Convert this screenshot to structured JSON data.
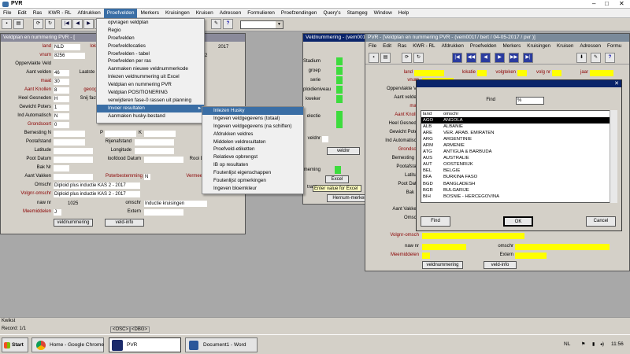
{
  "app": {
    "title": "PVR"
  },
  "menubar": [
    "File",
    "Edit",
    "Ras",
    "KWR - RL",
    "Afdrukken",
    "Proefvelden",
    "Merkers",
    "Kruisingen",
    "Kruisen",
    "Adressen",
    "Formulieren",
    "Proefzendingen",
    "Query's",
    "Stamgeg",
    "Window",
    "Help"
  ],
  "win1": {
    "title": "Veldplan en nummering PVR - ["
  },
  "win2": {
    "title": "Veldnummering - (vem001f)"
  },
  "win3": {
    "title": "PVR - [Veldplan en nummering PVR - (vem001f / bert / 04-05-2017 / pvr )]",
    "menu": [
      "File",
      "Edit",
      "Ras",
      "KWR - RL",
      "Afdrukken",
      "Proefvelden",
      "Merkers",
      "Kruisingen",
      "Kruisen",
      "Adressen",
      "Formu"
    ]
  },
  "form1": {
    "land_label": "land",
    "land_value": "NLD",
    "lokatie_label": "lokat",
    "jaar_value": "2017",
    "jaar_value2": "2",
    "vnum_label": "vnum",
    "vnum_value": "8256",
    "opp_label": "Oppervlakte Veld",
    "aant_velden_label": "Aant velden",
    "aant_velden_value": "46",
    "laatste_label": "Laatste Ve",
    "maat_label": "maat",
    "maat_value": "30",
    "aant_knollen_label": "Aant Knollen",
    "aant_knollen_value": "8",
    "geoog_label": "geoog",
    "heel_label": "Heel Gesneden",
    "heel_value": "H",
    "snij_label": "Snij fact",
    "gewicht_label": "Gewicht Poters",
    "gewicht_value": "1",
    "ind_label": "Ind Automatisch",
    "ind_value": "N",
    "grondsoort_label": "Grondsoort",
    "grondsoort_value": "0",
    "bemesting_label": "Bemesting N",
    "p_label": "P",
    "k_label": "K",
    "pootafstand_label": "Pootafstand",
    "rijenafstand_label": "Rijenafstand",
    "latitude_label": "Latitude",
    "longitude_label": "Longitude",
    "pootdatum_label": "Poot Datum",
    "loofdood_label": "loofdood Datum",
    "rooi_label": "Rooi D",
    "bak_label": "Bak Nr",
    "aant_vakken_label": "Aant Vakken",
    "poterbestemming_label": "Poterbestemming",
    "poterbestemming_value": "N",
    "vermeer_label": "Vermeer",
    "omschr_label": "Omschr",
    "omschr_value": "Diploid plus inductie KAS 2 - 2017",
    "volgnr_label": "Volgnr-omschr",
    "volgnr_value": "Diploid plus inductie KAS 2 - 2017",
    "naw_label": "naw nr",
    "naw_value": "1025",
    "naw_omschr_label": "omschr",
    "naw_omschr_value": "Inductie kruisingen",
    "meemiddelen_label": "Meemiddelen",
    "meemiddelen_value": "J",
    "extern_label": "Extern",
    "btn_veldnummering": "veldnummering",
    "btn_veldinfo": "veld-info"
  },
  "proefvelden_menu": [
    "opvragen veldplan",
    "Regio",
    "Proefvelden",
    "Proefveldlocaties",
    "Proefvelden - tabel",
    "Proefvelden per ras",
    "Aanmaken nieuwe veldnummerkode",
    "Inlezen veldnummering uit Excel",
    "Veldplan en nummering PVR",
    "Veldplan POSITIONERING",
    "verwijderen fase-0 rassen uit planning",
    "Invoer resultaten",
    "Aanmaken husky-bestand"
  ],
  "proefvelden_menu_highlight": 11,
  "invoer_submenu": [
    "Inlezen Husky",
    "Ingeven veldgegevens (totaal)",
    "Ingeven veldgegevens (na schiften)",
    "Afdrukken veldres",
    "Middelen veldresultaten",
    "Proefveld-etiketten",
    "Relatieve opbrengst",
    "IB op resultaten",
    "Foutenlijst eigenschappen",
    "Foutenlijst opmerkingen",
    "Ingeven bloemkleur"
  ],
  "invoer_submenu_highlight": 0,
  "veldnummering": {
    "stadium_label": "Stadium",
    "groep_label": "groep",
    "serie_label": "serie",
    "ploidie_label": "ploidieniveau",
    "kweker_label": "kweker",
    "selectie_label": "electie",
    "veldnr_button": "veldnr",
    "veldnr_label": "veldnr",
    "meming_label": "meming",
    "tra_label": "tra",
    "excel_button": "Excel",
    "tooltip": "Enter value for Excel",
    "hernum_button": "Hernum-merken"
  },
  "form3": {
    "hdr_land": "land",
    "hdr_lokatie": "lokatie",
    "hdr_volgteken": "volgteken",
    "hdr_volgnr": "volg nr",
    "hdr_jaar": "jaar",
    "vnum": "vnum",
    "opp": "Oppervlakte Ve",
    "aant_velden": "Aant velden",
    "maat": "maa",
    "aant_knollen": "Aant Knolle",
    "heel": "Heel Gesnede",
    "gewicht": "Gewicht Poter",
    "ind": "Ind Automatisch",
    "grondsoort": "Grondsoo",
    "bemesting": "Bemesting N",
    "pootafstand": "Pootafstan",
    "latitude": "Latitud",
    "pootdatum": "Poot Datu",
    "bak": "Bak N",
    "aant_vakken": "Aant Vakken",
    "omschr": "Omsch",
    "volgnr": "Volgnr-omsch",
    "naw": "naw nr",
    "omschr2": "omschr",
    "meemiddelen": "Meemiddelen",
    "extern": "Extern",
    "btn_veldnummering": "veldnummering",
    "btn_veldinfo": "veld-info"
  },
  "dialog": {
    "find_label": "Find",
    "find_value": "%",
    "col_land": "land",
    "col_omschr": "omschr",
    "rows": [
      [
        "AGO",
        "ANGOLA"
      ],
      [
        "ALB",
        "ALBANIE"
      ],
      [
        "ARE",
        "VER. ARAB. EMIRATEN"
      ],
      [
        "ARG",
        "ARGENTINIE"
      ],
      [
        "ARM",
        "ARMENIE"
      ],
      [
        "ATG",
        "ANTIGUA & BARBUDA"
      ],
      [
        "AUS",
        "AUSTRALIE"
      ],
      [
        "AUT",
        "OOSTENRIJK"
      ],
      [
        "BEL",
        "BELGIE"
      ],
      [
        "BFA",
        "BURKINA FASO"
      ],
      [
        "BGD",
        "BANGLADESH"
      ],
      [
        "BGR",
        "BULGARIJE"
      ],
      [
        "BIH",
        "BOSNIE - HERCEGOVINA"
      ]
    ],
    "selected": 0,
    "btn_find": "Find",
    "btn_ok": "OK",
    "btn_cancel": "Cancel"
  },
  "status": {
    "line1": "Kwikst",
    "line2": "Record: 1/1",
    "osc": "<OSC>",
    "dbg": "<DBG>"
  },
  "taskbar": {
    "start": "Start",
    "chrome": "Home - Google Chrome",
    "pvr": "PVR",
    "word": "Document1 - Word",
    "lang": "NL",
    "time": "11:56"
  }
}
